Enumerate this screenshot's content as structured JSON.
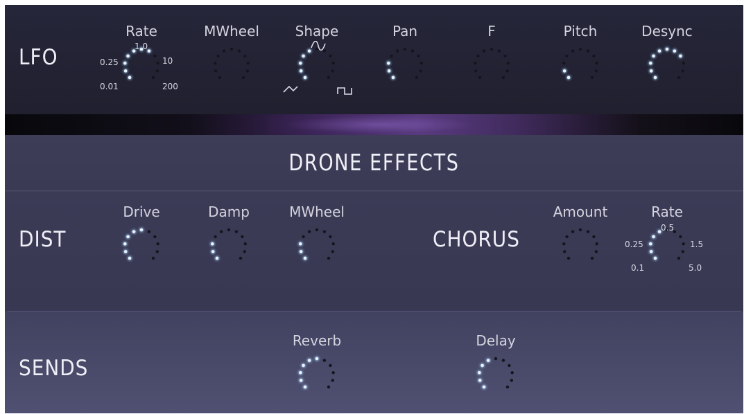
{
  "colors": {
    "dot_on": "#e8f4ff",
    "dot_off": "#15151e"
  },
  "lfo": {
    "title": "LFO",
    "knobs": [
      {
        "label": "Rate",
        "value": 0.55,
        "ticks": [
          "1.0",
          "0.25",
          "10",
          "0.01",
          "200"
        ]
      },
      {
        "label": "MWheel",
        "value": 0.0
      },
      {
        "label": "Shape",
        "value": 0.35
      },
      {
        "label": "Pan",
        "value": 0.2
      },
      {
        "label": "F",
        "value": 0.0
      },
      {
        "label": "Pitch",
        "value": 0.1
      },
      {
        "label": "Desync",
        "value": 0.7
      }
    ],
    "shape_icons": [
      "sine-wave-icon",
      "triangle-wave-icon",
      "square-wave-icon"
    ]
  },
  "drone_effects": {
    "title": "DRONE EFFECTS"
  },
  "dist": {
    "title": "DIST",
    "knobs": [
      {
        "label": "Drive",
        "value": 0.45
      },
      {
        "label": "Damp",
        "value": 0.2
      },
      {
        "label": "MWheel",
        "value": 0.2
      }
    ]
  },
  "chorus": {
    "title": "CHORUS",
    "knobs": [
      {
        "label": "Amount",
        "value": 0.0
      },
      {
        "label": "Rate",
        "value": 0.4,
        "ticks": [
          "0.5",
          "0.25",
          "1.5",
          "0.1",
          "5.0"
        ]
      }
    ]
  },
  "sends": {
    "title": "SENDS",
    "knobs": [
      {
        "label": "Reverb",
        "value": 0.5
      },
      {
        "label": "Delay",
        "value": 0.35
      }
    ]
  }
}
